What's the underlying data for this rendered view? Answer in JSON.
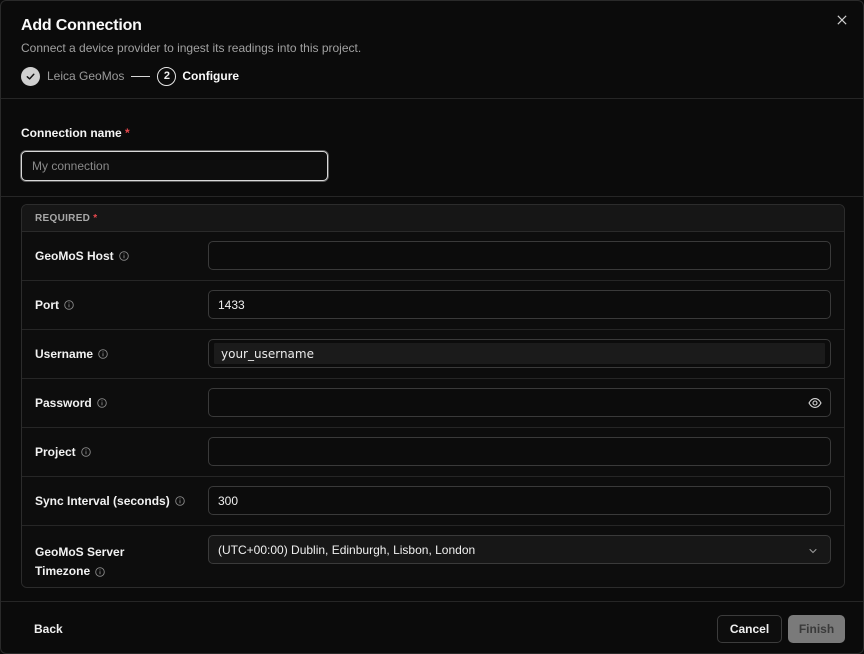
{
  "dialog": {
    "title": "Add Connection",
    "subtitle": "Connect a device provider to ingest its readings into this project.",
    "close_icon": "close-icon"
  },
  "stepper": {
    "steps": [
      {
        "label": "Leica GeoMos",
        "state": "done",
        "icon": "check-icon"
      },
      {
        "number": "2",
        "label": "Configure",
        "state": "active"
      }
    ]
  },
  "connection_name": {
    "label": "Connection name",
    "required_mark": "*",
    "value": "",
    "placeholder": "My connection"
  },
  "required_section": {
    "heading": "REQUIRED",
    "required_mark": "*",
    "fields": [
      {
        "label": "GeoMoS Host",
        "value": "",
        "icon": "info-icon"
      },
      {
        "label": "Port",
        "value": "1433",
        "icon": "info-icon"
      },
      {
        "label": "Username",
        "value": "your_username",
        "icon": "info-icon"
      },
      {
        "label": "Password",
        "value": "",
        "icon": "info-icon",
        "trailing_icon": "eye-icon"
      },
      {
        "label": "Project",
        "value": "",
        "icon": "info-icon"
      },
      {
        "label": "Sync Interval (seconds)",
        "value": "300",
        "icon": "info-icon"
      }
    ],
    "timezone": {
      "label_line1": "GeoMoS Server",
      "label_line2": "Timezone",
      "icon": "info-icon",
      "selected": "(UTC+00:00) Dublin, Edinburgh, Lisbon, London",
      "trailing_icon": "chevron-down-icon"
    }
  },
  "footer": {
    "back_label": "Back",
    "cancel_label": "Cancel",
    "finish_label": "Finish",
    "finish_disabled": true
  },
  "colors": {
    "background": "#0b0b0b",
    "required_star": "#e5484d",
    "finish_disabled_bg": "#7a7a7a"
  }
}
